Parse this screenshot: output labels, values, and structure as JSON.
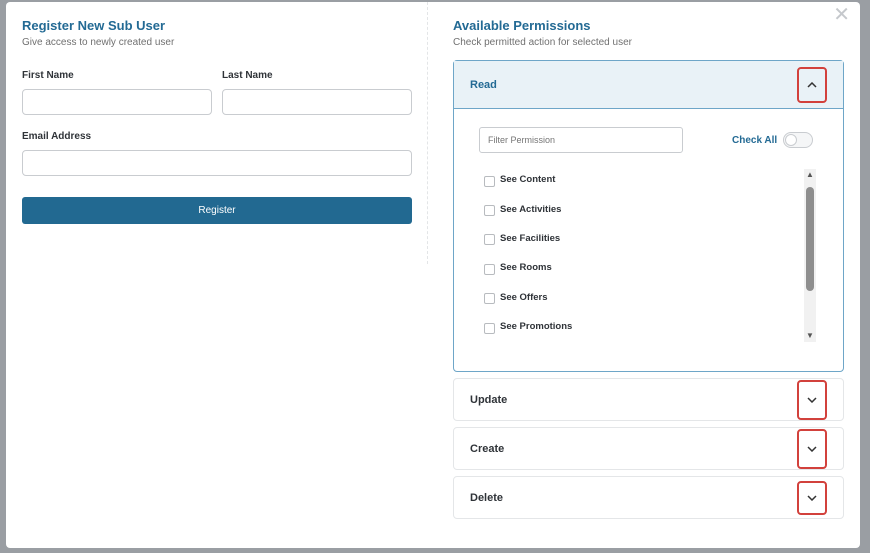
{
  "left": {
    "title": "Register New Sub User",
    "subtitle": "Give access to newly created user",
    "first_name_label": "First Name",
    "last_name_label": "Last Name",
    "email_label": "Email Address",
    "register_label": "Register"
  },
  "right": {
    "title": "Available Permissions",
    "subtitle": "Check permitted action for selected user",
    "read": {
      "title": "Read",
      "filter_placeholder": "Filter Permission",
      "check_all_label": "Check All",
      "items": [
        "See Content",
        "See Activities",
        "See Facilities",
        "See Rooms",
        "See Offers",
        "See Promotions"
      ]
    },
    "update_title": "Update",
    "create_title": "Create",
    "delete_title": "Delete"
  },
  "close_icon_glyph": "✕",
  "colors": {
    "accent": "#236a94",
    "button": "#226991",
    "highlight": "#d2413c"
  }
}
